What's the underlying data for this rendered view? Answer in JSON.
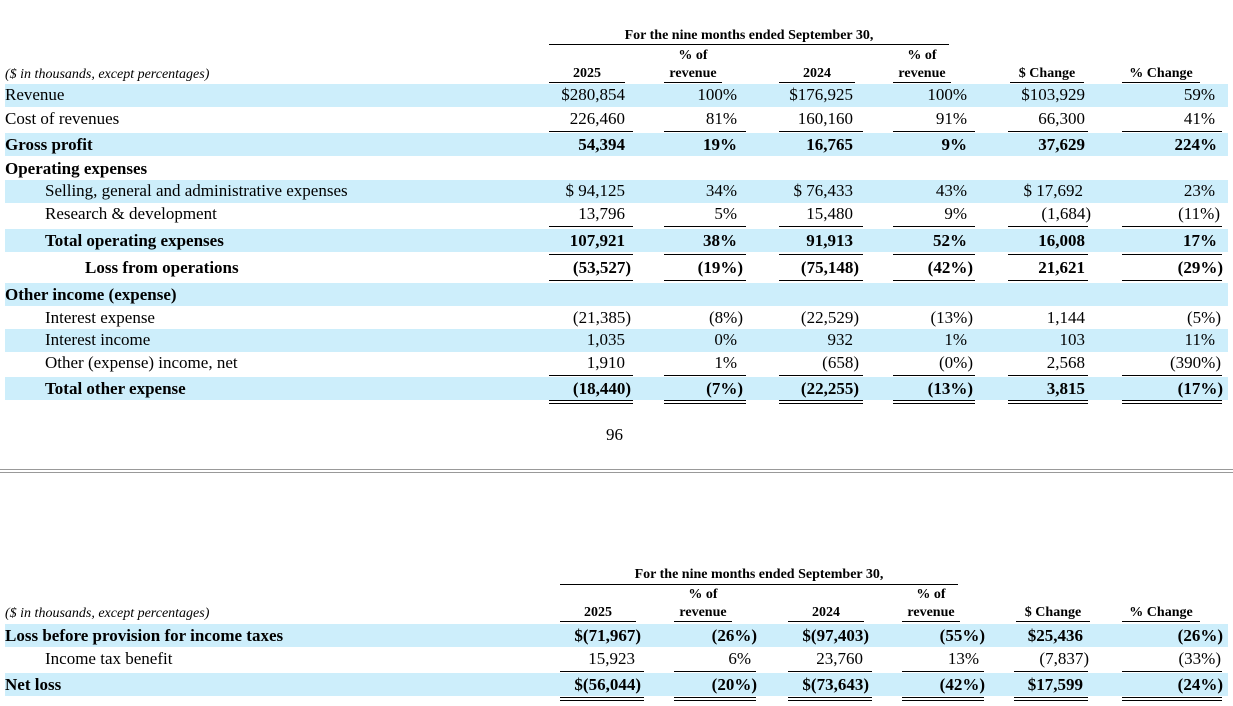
{
  "table1": {
    "period_header": "For the nine months ended September 30,",
    "units_note": "($ in thousands, except percentages)",
    "col_headers": {
      "y1": "2025",
      "pct1_line1": "% of",
      "pct1_line2": "revenue",
      "y2": "2024",
      "pct2_line1": "% of",
      "pct2_line2": "revenue",
      "change": "$ Change",
      "pct_change": "% Change"
    },
    "rows": [
      {
        "label": "Revenue",
        "v1": "$280,854",
        "p1": "100%",
        "v2": "$176,925",
        "p2": "100%",
        "chg": "$103,929",
        "pchg": "59%"
      },
      {
        "label": "Cost of revenues",
        "v1": "226,460",
        "p1": "81%",
        "v2": "160,160",
        "p2": "91%",
        "chg": "66,300",
        "pchg": "41%"
      },
      {
        "label": "Gross profit",
        "v1": "54,394",
        "p1": "19%",
        "v2": "16,765",
        "p2": "9%",
        "chg": "37,629",
        "pchg": "224%"
      },
      {
        "label": "Operating expenses"
      },
      {
        "label": "Selling, general and administrative expenses",
        "v1": "$ 94,125",
        "p1": "34%",
        "v2": "$ 76,433",
        "p2": "43%",
        "chg": "$ 17,692",
        "pchg": "23%"
      },
      {
        "label": "Research & development",
        "v1": "13,796",
        "p1": "5%",
        "v2": "15,480",
        "p2": "9%",
        "chg": "(1,684)",
        "pchg": "(11%)"
      },
      {
        "label": "Total operating expenses",
        "v1": "107,921",
        "p1": "38%",
        "v2": "91,913",
        "p2": "52%",
        "chg": "16,008",
        "pchg": "17%"
      },
      {
        "label": "Loss from operations",
        "v1": "(53,527)",
        "p1": "(19%)",
        "v2": "(75,148)",
        "p2": "(42%)",
        "chg": "21,621",
        "pchg": "(29%)"
      },
      {
        "label": "Other income (expense)"
      },
      {
        "label": "Interest expense",
        "v1": "(21,385)",
        "p1": "(8%)",
        "v2": "(22,529)",
        "p2": "(13%)",
        "chg": "1,144",
        "pchg": "(5%)"
      },
      {
        "label": "Interest income",
        "v1": "1,035",
        "p1": "0%",
        "v2": "932",
        "p2": "1%",
        "chg": "103",
        "pchg": "11%"
      },
      {
        "label": "Other (expense) income, net",
        "v1": "1,910",
        "p1": "1%",
        "v2": "(658)",
        "p2": "(0%)",
        "chg": "2,568",
        "pchg": "(390%)"
      },
      {
        "label": "Total other expense",
        "v1": "(18,440)",
        "p1": "(7%)",
        "v2": "(22,255)",
        "p2": "(13%)",
        "chg": "3,815",
        "pchg": "(17%)"
      }
    ]
  },
  "page_number": "96",
  "table2": {
    "period_header": "For the nine months ended September 30,",
    "units_note": "($ in thousands, except percentages)",
    "col_headers": {
      "y1": "2025",
      "pct1_line1": "% of",
      "pct1_line2": "revenue",
      "y2": "2024",
      "pct2_line1": "% of",
      "pct2_line2": "revenue",
      "change": "$ Change",
      "pct_change": "% Change"
    },
    "rows": [
      {
        "label": "Loss before provision for income taxes",
        "v1": "$(71,967)",
        "p1": "(26%)",
        "v2": "$(97,403)",
        "p2": "(55%)",
        "chg": "$25,436",
        "pchg": "(26%)"
      },
      {
        "label": "Income tax benefit",
        "v1": "15,923",
        "p1": "6%",
        "v2": "23,760",
        "p2": "13%",
        "chg": "(7,837)",
        "pchg": "(33%)"
      },
      {
        "label": "Net loss",
        "v1": "$(56,044)",
        "p1": "(20%)",
        "v2": "$(73,643)",
        "p2": "(42%)",
        "chg": "$17,599",
        "pchg": "(24%)"
      }
    ]
  }
}
